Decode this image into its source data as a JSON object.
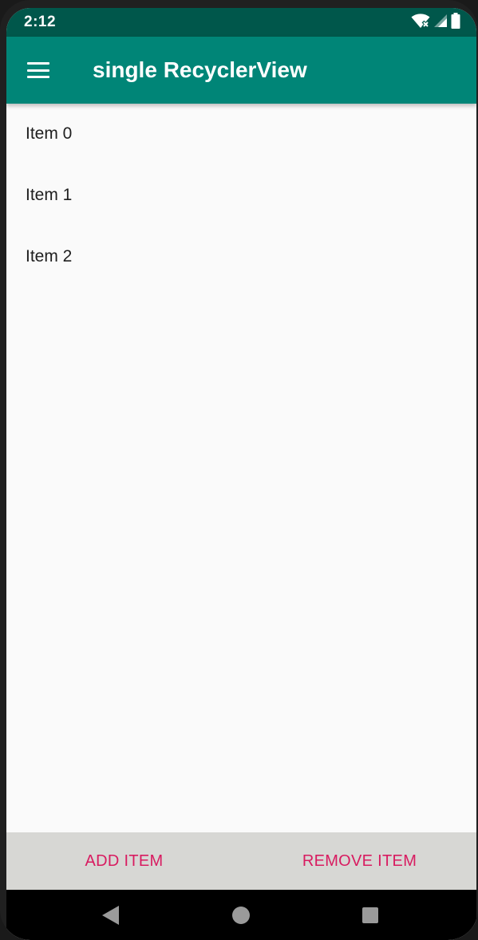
{
  "status_bar": {
    "time": "2:12",
    "icons": [
      "wifi-icon",
      "cellular-signal-icon",
      "battery-icon"
    ]
  },
  "app_bar": {
    "title": "single RecyclerView",
    "menu_icon": "hamburger-menu-icon"
  },
  "list": {
    "items": [
      {
        "label": "Item 0"
      },
      {
        "label": "Item 1"
      },
      {
        "label": "Item 2"
      }
    ]
  },
  "bottom_bar": {
    "add_label": "ADD ITEM",
    "remove_label": "REMOVE ITEM"
  },
  "navigation": {
    "icons": [
      "back-icon",
      "home-icon",
      "recents-icon"
    ]
  },
  "colors": {
    "status_bar": "#00574b",
    "app_bar": "#008577",
    "accent": "#d81b60",
    "background": "#fafafa",
    "button_bar": "#d7d7d4"
  }
}
